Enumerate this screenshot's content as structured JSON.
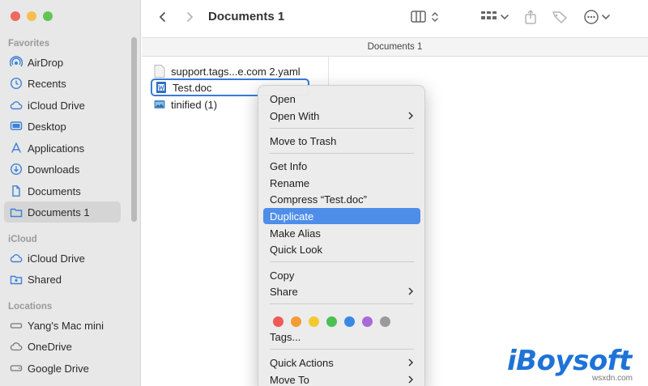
{
  "window": {
    "title": "Documents 1",
    "path_title": "Documents 1"
  },
  "sidebar": {
    "sections": [
      {
        "label": "Favorites",
        "items": [
          {
            "label": "AirDrop",
            "icon": "airdrop-icon"
          },
          {
            "label": "Recents",
            "icon": "clock-icon"
          },
          {
            "label": "iCloud Drive",
            "icon": "cloud-icon"
          },
          {
            "label": "Desktop",
            "icon": "desktop-icon"
          },
          {
            "label": "Applications",
            "icon": "applications-icon"
          },
          {
            "label": "Downloads",
            "icon": "download-icon"
          },
          {
            "label": "Documents",
            "icon": "document-icon"
          },
          {
            "label": "Documents 1",
            "icon": "folder-icon",
            "selected": true
          }
        ]
      },
      {
        "label": "iCloud",
        "items": [
          {
            "label": "iCloud Drive",
            "icon": "cloud-icon"
          },
          {
            "label": "Shared",
            "icon": "shared-folder-icon"
          }
        ]
      },
      {
        "label": "Locations",
        "items": [
          {
            "label": "Yang's Mac mini",
            "icon": "computer-icon"
          },
          {
            "label": "OneDrive",
            "icon": "cloud-icon"
          },
          {
            "label": "Google Drive",
            "icon": "drive-icon"
          }
        ]
      }
    ]
  },
  "files": [
    {
      "name": "support.tags...e.com 2.yaml",
      "icon": "yaml-file-icon"
    },
    {
      "name": "Test.doc",
      "icon": "word-doc-icon",
      "selected": true
    },
    {
      "name": "tinified (1)",
      "icon": "image-folder-icon"
    }
  ],
  "context_menu": {
    "items": [
      {
        "label": "Open"
      },
      {
        "label": "Open With",
        "submenu": true
      },
      {
        "label": "Move to Trash"
      },
      {
        "label": "Get Info"
      },
      {
        "label": "Rename"
      },
      {
        "label": "Compress “Test.doc”"
      },
      {
        "label": "Duplicate",
        "highlighted": true
      },
      {
        "label": "Make Alias"
      },
      {
        "label": "Quick Look"
      },
      {
        "label": "Copy"
      },
      {
        "label": "Share",
        "submenu": true
      },
      {
        "label": "Tags..."
      },
      {
        "label": "Quick Actions",
        "submenu": true
      },
      {
        "label": "Move To",
        "submenu": true
      }
    ],
    "tag_colors": [
      "#ee5b57",
      "#f39c33",
      "#f2ca2f",
      "#4cbf55",
      "#3a88e6",
      "#a86ad8",
      "#9b9b9b"
    ]
  },
  "branding": {
    "logo": "iBoysoft",
    "watermark": "wsxdn.com"
  },
  "colors": {
    "accent": "#4f8ee8",
    "selection_border": "#3a7bd5",
    "sidebar_bg": "#e9e8e8"
  }
}
